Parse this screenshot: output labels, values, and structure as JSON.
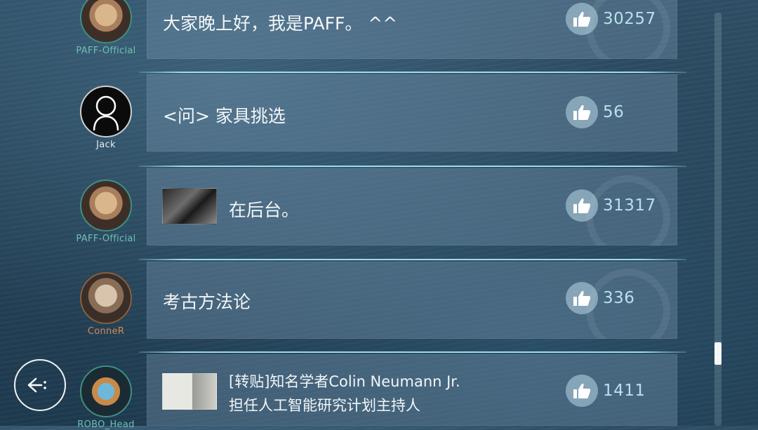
{
  "posts": [
    {
      "author": "PAFF-Official",
      "title": "大家晚上好，我是PAFF。 ^^",
      "likes": "30257",
      "thumbnail": null,
      "avatar": "paff-avatar"
    },
    {
      "author": "Jack",
      "title": "<问> 家具挑选",
      "likes": "56",
      "thumbnail": null,
      "avatar": "silhouette-avatar"
    },
    {
      "author": "PAFF-Official",
      "title": "在后台。",
      "likes": "31317",
      "thumbnail": "backstage-photo",
      "avatar": "paff-avatar"
    },
    {
      "author": "ConneR",
      "title": "考古方法论",
      "likes": "336",
      "thumbnail": null,
      "avatar": "conner-avatar"
    },
    {
      "author": "ROBO_Head",
      "title_line1": "[转贴]知名学者Colin Neumann Jr.",
      "title_line2": "担任人工智能研究计划主持人",
      "likes": "1411",
      "thumbnail": "newspaper-clip",
      "avatar": "robo-head-avatar"
    }
  ],
  "icons": {
    "like": "thumbs-up-icon",
    "back": "back-arrow-icon"
  },
  "colors": {
    "accent": "#6fbfb3",
    "like_count": "#b9e0ec",
    "divider": "#aaebf5",
    "conner_name": "#d48a52"
  }
}
